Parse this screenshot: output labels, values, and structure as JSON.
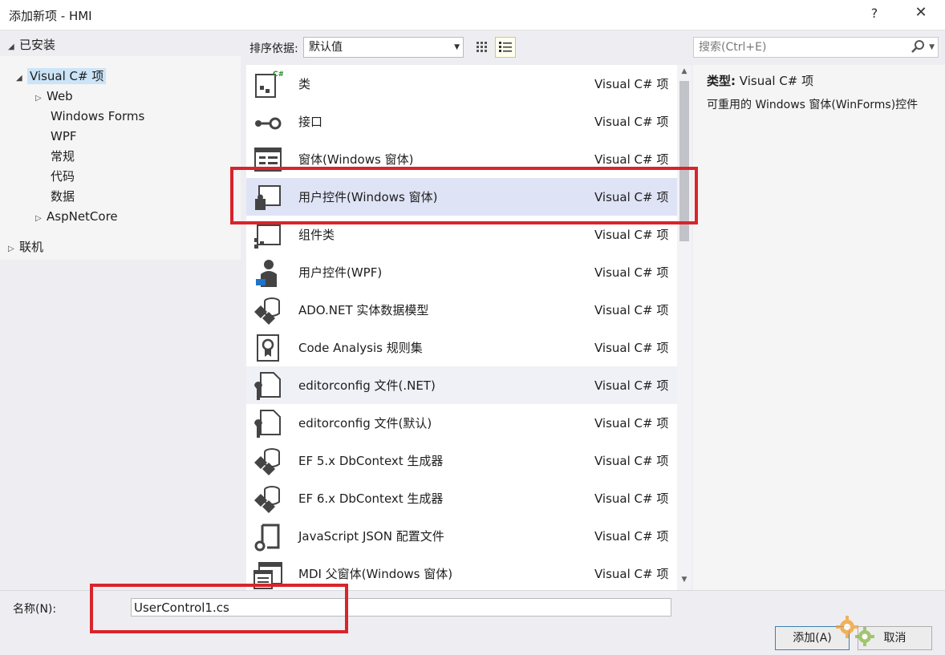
{
  "window": {
    "title": "添加新项 - HMI",
    "help_label": "?",
    "close_label": "✕"
  },
  "tree": {
    "installed": "已安装",
    "visual_cs": "Visual C# 项",
    "children": [
      "Web",
      "Windows Forms",
      "WPF",
      "常规",
      "代码",
      "数据",
      "AspNetCore"
    ],
    "online": "联机"
  },
  "toolbar": {
    "sort_label": "排序依据:",
    "sort_value": "默认值",
    "search_placeholder": "搜索(Ctrl+E)"
  },
  "items": [
    {
      "name": "类",
      "category": "Visual C# 项",
      "icon": "class-icon"
    },
    {
      "name": "接口",
      "category": "Visual C# 项",
      "icon": "interface-icon"
    },
    {
      "name": "窗体(Windows 窗体)",
      "category": "Visual C# 项",
      "icon": "form-icon"
    },
    {
      "name": "用户控件(Windows 窗体)",
      "category": "Visual C# 项",
      "icon": "user-control-icon",
      "selected": true
    },
    {
      "name": "组件类",
      "category": "Visual C# 项",
      "icon": "component-icon"
    },
    {
      "name": "用户控件(WPF)",
      "category": "Visual C# 项",
      "icon": "wpf-user-control-icon"
    },
    {
      "name": "ADO.NET 实体数据模型",
      "category": "Visual C# 项",
      "icon": "entity-model-icon"
    },
    {
      "name": "Code Analysis 规则集",
      "category": "Visual C# 项",
      "icon": "ruleset-icon"
    },
    {
      "name": "editorconfig 文件(.NET)",
      "category": "Visual C# 项",
      "icon": "editorconfig-icon",
      "hover": true
    },
    {
      "name": "editorconfig 文件(默认)",
      "category": "Visual C# 项",
      "icon": "editorconfig-icon"
    },
    {
      "name": "EF 5.x DbContext 生成器",
      "category": "Visual C# 项",
      "icon": "ef-generator-icon"
    },
    {
      "name": "EF 6.x DbContext 生成器",
      "category": "Visual C# 项",
      "icon": "ef-generator-icon"
    },
    {
      "name": "JavaScript JSON 配置文件",
      "category": "Visual C# 项",
      "icon": "json-config-icon"
    },
    {
      "name": "MDI 父窗体(Windows 窗体)",
      "category": "Visual C# 项",
      "icon": "mdi-form-icon"
    }
  ],
  "details": {
    "type_label": "类型:",
    "type_value": "Visual C# 项",
    "description": "可重用的 Windows 窗体(WinForms)控件"
  },
  "bottom": {
    "name_label": "名称(N):",
    "name_value": "UserControl1.cs",
    "add_label": "添加(A)",
    "cancel_label": "取消"
  },
  "colors": {
    "highlight_red": "#d9242b",
    "selected_row": "#dfe3f6",
    "tree_selected": "#cce4f7"
  }
}
